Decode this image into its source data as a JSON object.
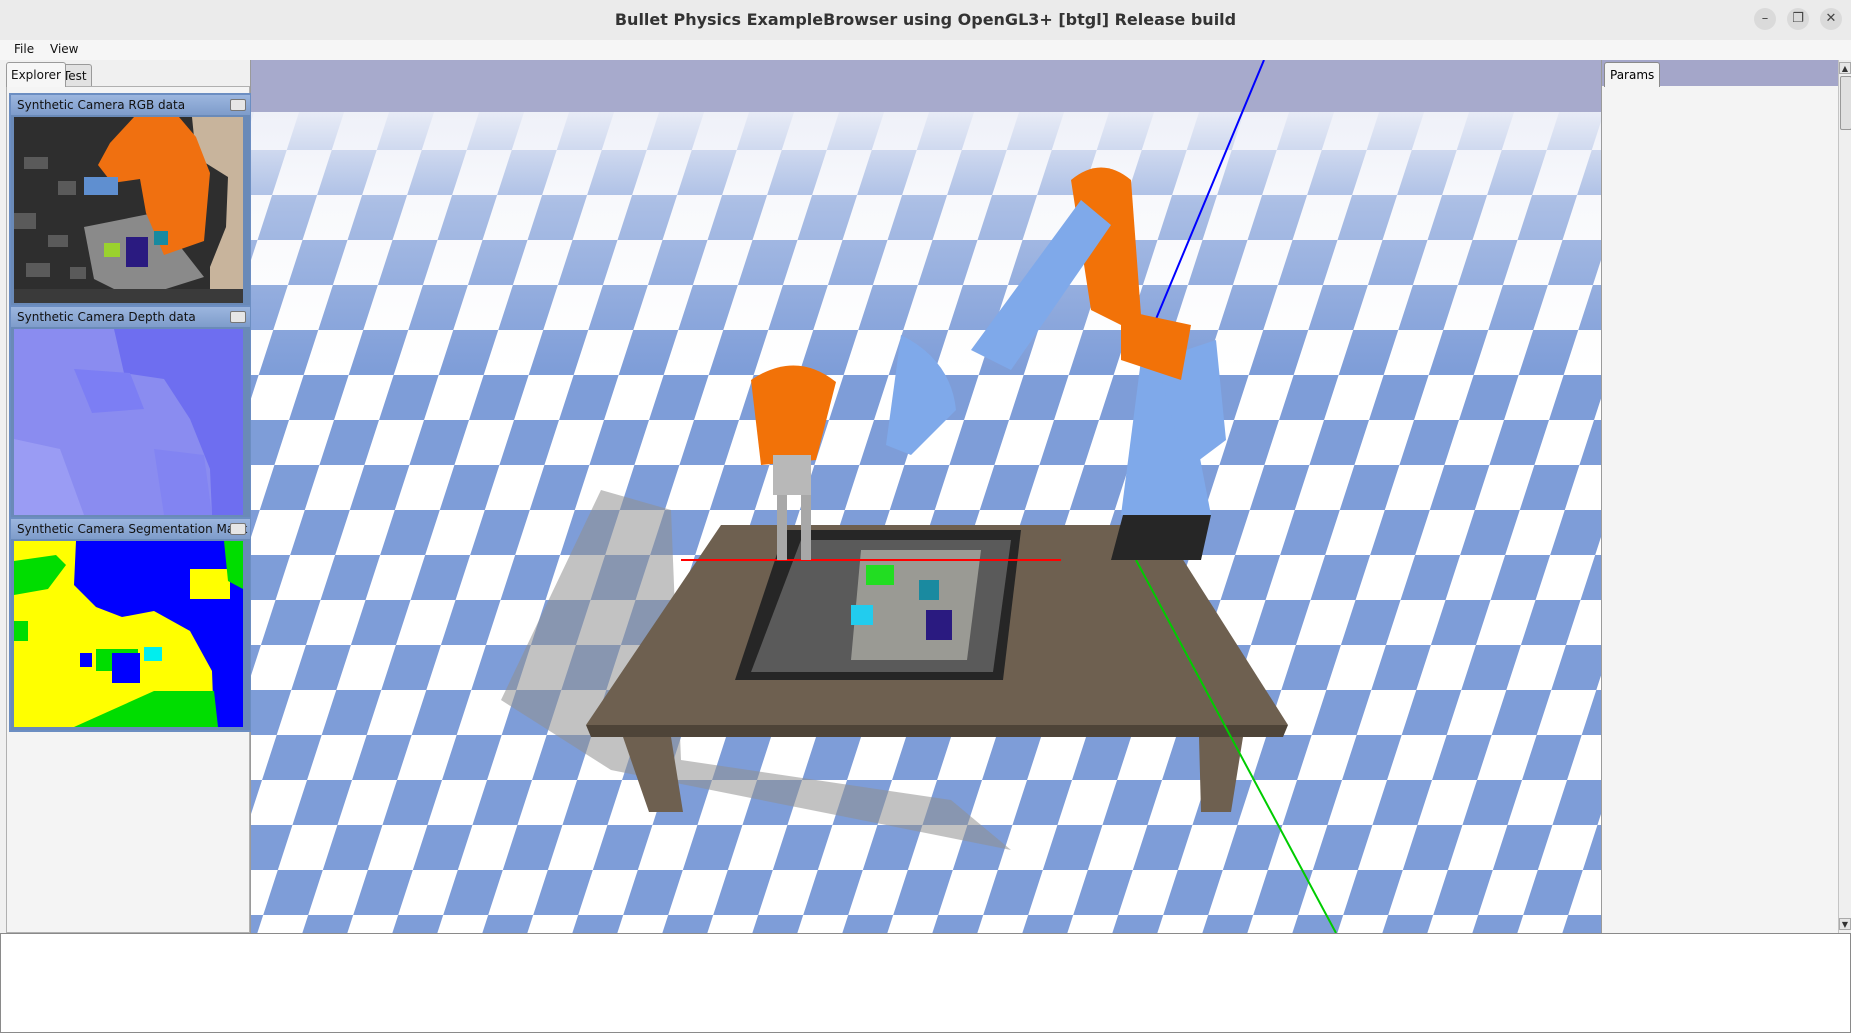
{
  "window": {
    "title": "Bullet Physics ExampleBrowser using OpenGL3+ [btgl] Release build",
    "minimize_glyph": "–",
    "restore_glyph": "❐",
    "close_glyph": "✕"
  },
  "menu": {
    "file": "File",
    "view": "View"
  },
  "left_tabs": {
    "explorer": "Explorer",
    "test": "Test"
  },
  "camera_windows": {
    "rgb": "Synthetic Camera RGB data",
    "depth": "Synthetic Camera Depth data",
    "segmentation": "Synthetic Camera Segmentation Mask"
  },
  "right_panel": {
    "tab": "Params"
  },
  "scrollbar": {
    "up_glyph": "▲",
    "down_glyph": "▼"
  },
  "icons": [
    "minimize-icon",
    "restore-icon",
    "close-icon",
    "scroll-up-icon",
    "scroll-down-icon"
  ],
  "colors": {
    "sky": "#a7aacc",
    "floor_light": "#ffffff",
    "floor_blue": "#7e9dd8",
    "robot_orange": "#f27208",
    "robot_blue": "#7fa9ea",
    "table_wood": "#6e6050",
    "axis_red": "#ff0000",
    "axis_green": "#00cc00",
    "axis_blue": "#0000ff"
  }
}
